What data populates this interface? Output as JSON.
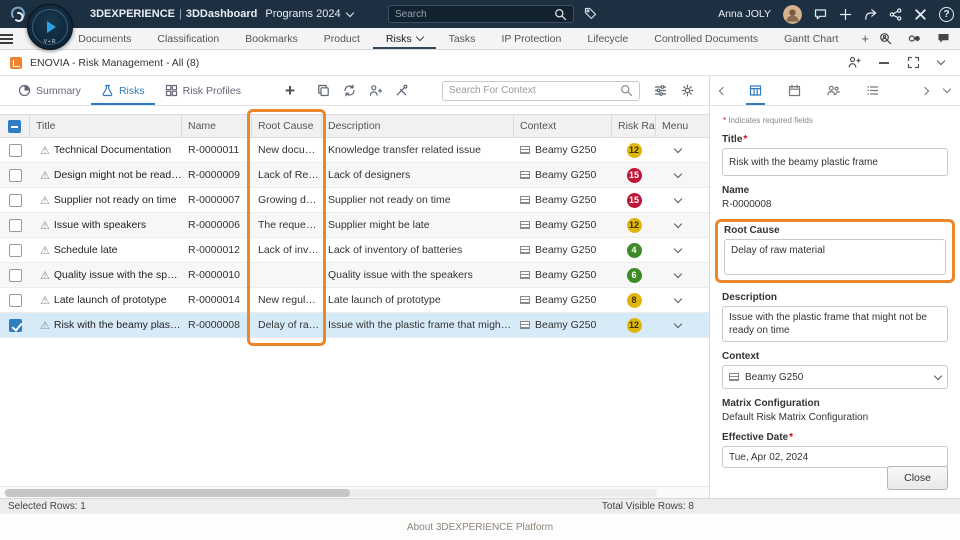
{
  "topbar": {
    "brand": "3DEXPERIENCE",
    "separator": "|",
    "app": "3DDashboard",
    "dashboard_name": "Programs 2024",
    "compass_label": "V+R",
    "search_placeholder": "Search",
    "user_name": "Anna JOLY",
    "help_glyph": "?"
  },
  "nav": {
    "tabs": [
      "Documents",
      "Classification",
      "Bookmarks",
      "Product",
      "Risks",
      "Tasks",
      "IP Protection",
      "Lifecycle",
      "Controlled Documents",
      "Gantt Chart"
    ],
    "active_tab": "Risks",
    "add_tab": "+"
  },
  "widget": {
    "title": "ENOVIA - Risk Management - All (8)"
  },
  "toolbar": {
    "tabs": [
      {
        "label": "Summary",
        "icon": "pie-chart-icon"
      },
      {
        "label": "Risks",
        "icon": "flask-icon"
      },
      {
        "label": "Risk Profiles",
        "icon": "grid-icon"
      }
    ],
    "active_tab": "Risks",
    "add_glyph": "+",
    "search_placeholder": "Search For Context"
  },
  "table": {
    "columns": [
      "Title",
      "Name",
      "Root Cause",
      "Description",
      "Context",
      "Risk Rat",
      "Menu"
    ],
    "rows": [
      {
        "title": "Technical Documentation",
        "name": "R-0000011",
        "root_cause": "New docu…",
        "description": "Knowledge transfer related issue",
        "context": "Beamy G250",
        "rating": "12",
        "rating_color": "#e0b60e",
        "rating_text_color": "#3a3000",
        "selected": false
      },
      {
        "title": "Design might not be ready o…",
        "name": "R-0000009",
        "root_cause": "Lack of Re…",
        "description": "Lack of designers",
        "context": "Beamy G250",
        "rating": "15",
        "rating_color": "#c01638",
        "rating_text_color": "#ffffff",
        "selected": false
      },
      {
        "title": "Supplier not ready on time",
        "name": "R-0000007",
        "root_cause": "Growing d…",
        "description": "Supplier not ready on time",
        "context": "Beamy G250",
        "rating": "15",
        "rating_color": "#c01638",
        "rating_text_color": "#ffffff",
        "selected": false
      },
      {
        "title": "Issue with speakers",
        "name": "R-0000006",
        "root_cause": "The reque…",
        "description": "Supplier might be late",
        "context": "Beamy G250",
        "rating": "12",
        "rating_color": "#e0b60e",
        "rating_text_color": "#3a3000",
        "selected": false
      },
      {
        "title": "Schedule late",
        "name": "R-0000012",
        "root_cause": "Lack of inv…",
        "description": "Lack of inventory of batteries",
        "context": "Beamy G250",
        "rating": "4",
        "rating_color": "#3e8a27",
        "rating_text_color": "#ffffff",
        "selected": false
      },
      {
        "title": "Quality issue with the speak…",
        "name": "R-0000010",
        "root_cause": "",
        "description": "Quality issue with the speakers",
        "context": "Beamy G250",
        "rating": "6",
        "rating_color": "#3e8a27",
        "rating_text_color": "#ffffff",
        "selected": false
      },
      {
        "title": "Late launch of prototype",
        "name": "R-0000014",
        "root_cause": "New regul…",
        "description": "Late launch of prototype",
        "context": "Beamy G250",
        "rating": "8",
        "rating_color": "#e0b60e",
        "rating_text_color": "#3a3000",
        "selected": false
      },
      {
        "title": "Risk with the beamy plastic …",
        "name": "R-0000008",
        "root_cause": "Delay of ra…",
        "description": "Issue with the plastic  frame that might not b…",
        "context": "Beamy G250",
        "rating": "12",
        "rating_color": "#e0b60e",
        "rating_text_color": "#3a3000",
        "selected": true
      }
    ]
  },
  "status": {
    "selected_rows": "Selected Rows: 1",
    "total_rows": "Total Visible Rows: 8"
  },
  "panel": {
    "required_marker": "*",
    "required_note": "Indicates required fields",
    "title": {
      "label": "Title",
      "value": "Risk with the beamy plastic frame"
    },
    "name": {
      "label": "Name",
      "value": "R-0000008"
    },
    "root_cause": {
      "label": "Root Cause",
      "value": "Delay of raw material"
    },
    "description": {
      "label": "Description",
      "value": "Issue with the plastic  frame that might not be ready on time"
    },
    "context": {
      "label": "Context",
      "value": "Beamy G250"
    },
    "matrix": {
      "label": "Matrix Configuration",
      "value": "Default Risk Matrix Configuration"
    },
    "effective_date": {
      "label": "Effective Date",
      "value": "Tue, Apr 02, 2024"
    },
    "close_label": "Close"
  },
  "footer": {
    "about": "About 3DEXPERIENCE Platform"
  },
  "colors": {
    "accent_blue": "#2e7cc1",
    "annotation_orange": "#ec862b",
    "selected_row_bg": "#d7eaf8",
    "topbar_bg": "#1d3042",
    "rating_yellow": "#e0b60e",
    "rating_red": "#c01638",
    "rating_green": "#3e8a27"
  }
}
